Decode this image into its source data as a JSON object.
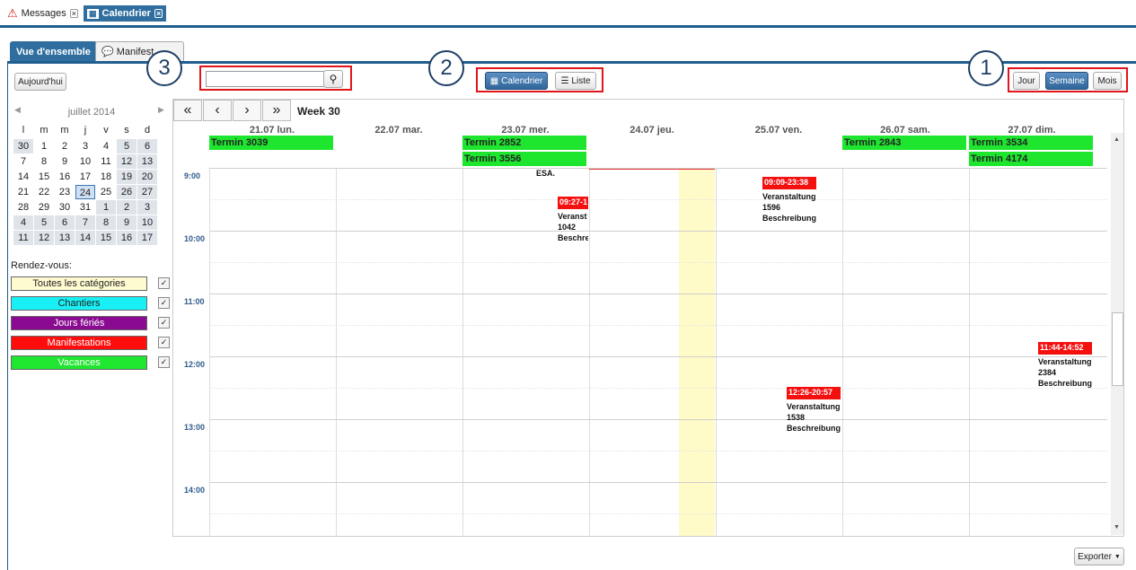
{
  "top_tabs": [
    {
      "label": "Messages",
      "icon": "warning-icon"
    },
    {
      "label": "Calendrier",
      "icon": "calendar-icon"
    }
  ],
  "sub_tabs": [
    {
      "label": "Vue d'ensemble"
    },
    {
      "label": "Manifest"
    }
  ],
  "today_button": "Aujourd'hui",
  "search": {
    "value": "",
    "placeholder": ""
  },
  "view_buttons": {
    "calendar": "Calendrier",
    "list": "Liste"
  },
  "period_buttons": {
    "day": "Jour",
    "week": "Semaine",
    "month": "Mois"
  },
  "callouts": [
    "1",
    "2",
    "3"
  ],
  "mini_calendar": {
    "month": "juillet 2014",
    "weekdays": [
      "l",
      "m",
      "m",
      "j",
      "v",
      "s",
      "d"
    ],
    "rows": [
      [
        "30",
        "1",
        "2",
        "3",
        "4",
        "5",
        "6"
      ],
      [
        "7",
        "8",
        "9",
        "10",
        "11",
        "12",
        "13"
      ],
      [
        "14",
        "15",
        "16",
        "17",
        "18",
        "19",
        "20"
      ],
      [
        "21",
        "22",
        "23",
        "24",
        "25",
        "26",
        "27"
      ],
      [
        "28",
        "29",
        "30",
        "31",
        "1",
        "2",
        "3"
      ],
      [
        "4",
        "5",
        "6",
        "7",
        "8",
        "9",
        "10"
      ],
      [
        "11",
        "12",
        "13",
        "14",
        "15",
        "16",
        "17"
      ]
    ]
  },
  "rendezvous_label": "Rendez-vous:",
  "categories": [
    {
      "label": "Toutes les catégories",
      "bg": "#fffbd0",
      "fg": "#222"
    },
    {
      "label": "Chantiers",
      "bg": "#19f0f5",
      "fg": "#222"
    },
    {
      "label": "Jours fériés",
      "bg": "#8a0b91",
      "fg": "#fff"
    },
    {
      "label": "Manifestations",
      "bg": "#ff0d0d",
      "fg": "#fff"
    },
    {
      "label": "Vacances",
      "bg": "#1fe62f",
      "fg": "#fff"
    }
  ],
  "week_label": "Week 30",
  "days": [
    "21.07 lun.",
    "22.07 mar.",
    "23.07 mer.",
    "24.07 jeu.",
    "25.07 ven.",
    "26.07 sam.",
    "27.07 dim."
  ],
  "all_day_events": [
    {
      "label": "Termin 3039"
    },
    {
      "label": "Termin 2852"
    },
    {
      "label": "Termin 3556"
    },
    {
      "label": "Termin 2843"
    },
    {
      "label": "Termin 3534"
    },
    {
      "label": "Termin 4174"
    }
  ],
  "hours": [
    "9:00",
    "10:00",
    "11:00",
    "12:00",
    "13:00",
    "14:00"
  ],
  "events": [
    {
      "time": "",
      "lines": [
        "ESA."
      ]
    },
    {
      "time": "09:27-1",
      "lines": [
        "Veranst",
        "1042",
        "Beschre"
      ]
    },
    {
      "time": "09:09-23:38",
      "lines": [
        "Veranstaltung",
        "1596",
        "Beschreibung"
      ]
    },
    {
      "time": "12:26-20:57",
      "lines": [
        "Veranstaltung",
        "1538",
        "Beschreibung"
      ]
    },
    {
      "time": "11:44-14:52",
      "lines": [
        "Veranstaltung",
        "2384",
        "Beschreibung"
      ]
    }
  ],
  "export_button": "Exporter",
  "colors": {
    "accent": "#1f5f8f",
    "event_red": "#f51010",
    "allday_green": "#1ee62e",
    "today_column": "#fffbc8"
  }
}
